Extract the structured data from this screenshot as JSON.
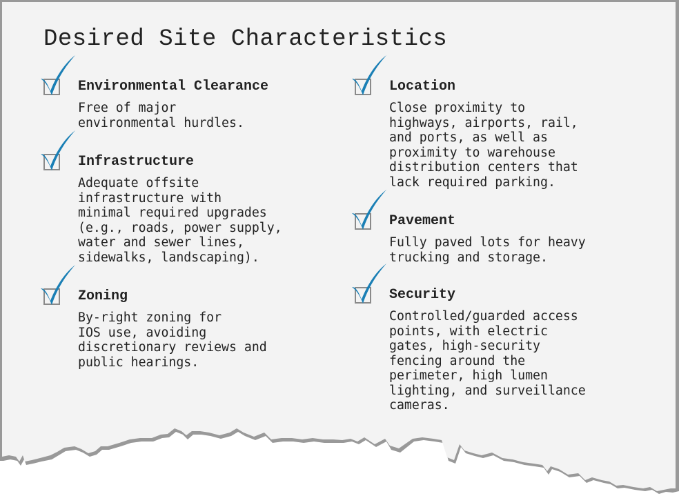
{
  "title": "Desired Site Characteristics",
  "colors": {
    "paper": "#f3f3f3",
    "edge": "#999999",
    "check": "#1a7fb5",
    "box": "#8a8a8a",
    "text": "#222222"
  },
  "icons": {
    "check": "checkmark-icon",
    "box": "checkbox-icon"
  },
  "left_column": [
    {
      "heading": "Environmental Clearance",
      "description": "Free of major\nenvironmental hurdles.",
      "checked": true
    },
    {
      "heading": "Infrastructure",
      "description": "Adequate offsite\ninfrastructure with\nminimal required upgrades\n(e.g., roads, power supply,\nwater and sewer lines,\nsidewalks, landscaping).",
      "checked": true
    },
    {
      "heading": "Zoning",
      "description": "By-right zoning for\nIOS use, avoiding\ndiscretionary reviews and\npublic hearings.",
      "checked": true
    }
  ],
  "right_column": [
    {
      "heading": "Location",
      "description": "Close proximity to\nhighways, airports, rail,\nand ports, as well as\nproximity to warehouse\ndistribution centers that\nlack required parking.",
      "checked": true
    },
    {
      "heading": "Pavement",
      "description": "Fully paved lots for heavy\ntrucking and storage.",
      "checked": true
    },
    {
      "heading": "Security",
      "description": "Controlled/guarded access\npoints, with electric\ngates, high-security\nfencing around the\nperimeter, high lumen\nlighting, and surveillance\ncameras.",
      "checked": true
    }
  ]
}
